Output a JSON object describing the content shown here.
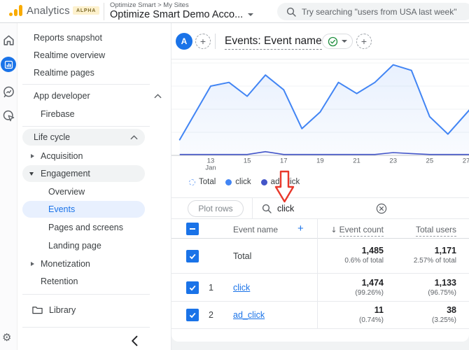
{
  "colors": {
    "accent_blue": "#1a73e8",
    "chart_line_blue": "#4285f4",
    "chart_ad_line": "#4355c8",
    "selected_pill_bg": "#e8f0fe",
    "annotation_red": "#e8382b",
    "logo_orange": "#f9ab00"
  },
  "topbar": {
    "brand": "Analytics",
    "badge": "ALPHA",
    "breadcrumb": "Optimize Smart > My Sites",
    "property": "Optimize Smart Demo Acco...",
    "search_placeholder": "Try searching \"users from USA last week\""
  },
  "sidebar": {
    "items": [
      "Reports snapshot",
      "Realtime overview",
      "Realtime pages",
      "App developer",
      "Firebase",
      "Life cycle",
      "Acquisition",
      "Engagement",
      "Overview",
      "Events",
      "Pages and screens",
      "Landing page",
      "Monetization",
      "Retention",
      "Library"
    ]
  },
  "report_header": {
    "avatar": "A",
    "add_comparison": "+",
    "title": "Events: Event name",
    "add_report": "+"
  },
  "chart_data": {
    "type": "line",
    "x_tick_labels": [
      "13",
      "15",
      "17",
      "19",
      "21",
      "23",
      "25",
      "27"
    ],
    "x_tick_days": [
      13,
      15,
      17,
      19,
      21,
      23,
      25,
      27
    ],
    "x_month_label": "Jan",
    "legend": [
      "Total",
      "click",
      "ad_click"
    ],
    "y_axis_visible": false,
    "y_units": "relative scale 0-100 (y-axis labels cropped out of visible area)",
    "series": [
      {
        "name": "click / Total",
        "x_days": [
          11.3,
          13,
          14,
          15,
          16,
          17,
          18,
          19,
          20,
          21,
          22,
          23,
          24,
          25,
          26,
          27.3
        ],
        "values": [
          17,
          75,
          79,
          64,
          87,
          71,
          29,
          47,
          79,
          67,
          79,
          98,
          92,
          42,
          23,
          52
        ]
      },
      {
        "name": "ad_click",
        "x_days": [
          11.3,
          14,
          15,
          16,
          17,
          18,
          22,
          23,
          24,
          25,
          27.3
        ],
        "values": [
          1,
          1,
          1,
          4,
          1,
          1,
          1,
          3,
          2,
          1,
          1
        ]
      }
    ]
  },
  "filter": {
    "plot_rows": "Plot rows",
    "search_value": "click"
  },
  "table": {
    "columns": {
      "dimension": "Event name",
      "add": "+",
      "sort_arrow": "↓",
      "metric1": "Event count",
      "metric2": "Total users"
    },
    "total_row": {
      "label": "Total",
      "event_count": "1,485",
      "event_count_sub": "0.6% of total",
      "total_users": "1,171",
      "total_users_sub": "2.57% of total"
    },
    "rows": [
      {
        "index": "1",
        "name": "click",
        "event_count": "1,474",
        "event_count_sub": "(99.26%)",
        "total_users": "1,133",
        "total_users_sub": "(96.75%)"
      },
      {
        "index": "2",
        "name": "ad_click",
        "event_count": "11",
        "event_count_sub": "(0.74%)",
        "total_users": "38",
        "total_users_sub": "(3.25%)"
      }
    ]
  }
}
